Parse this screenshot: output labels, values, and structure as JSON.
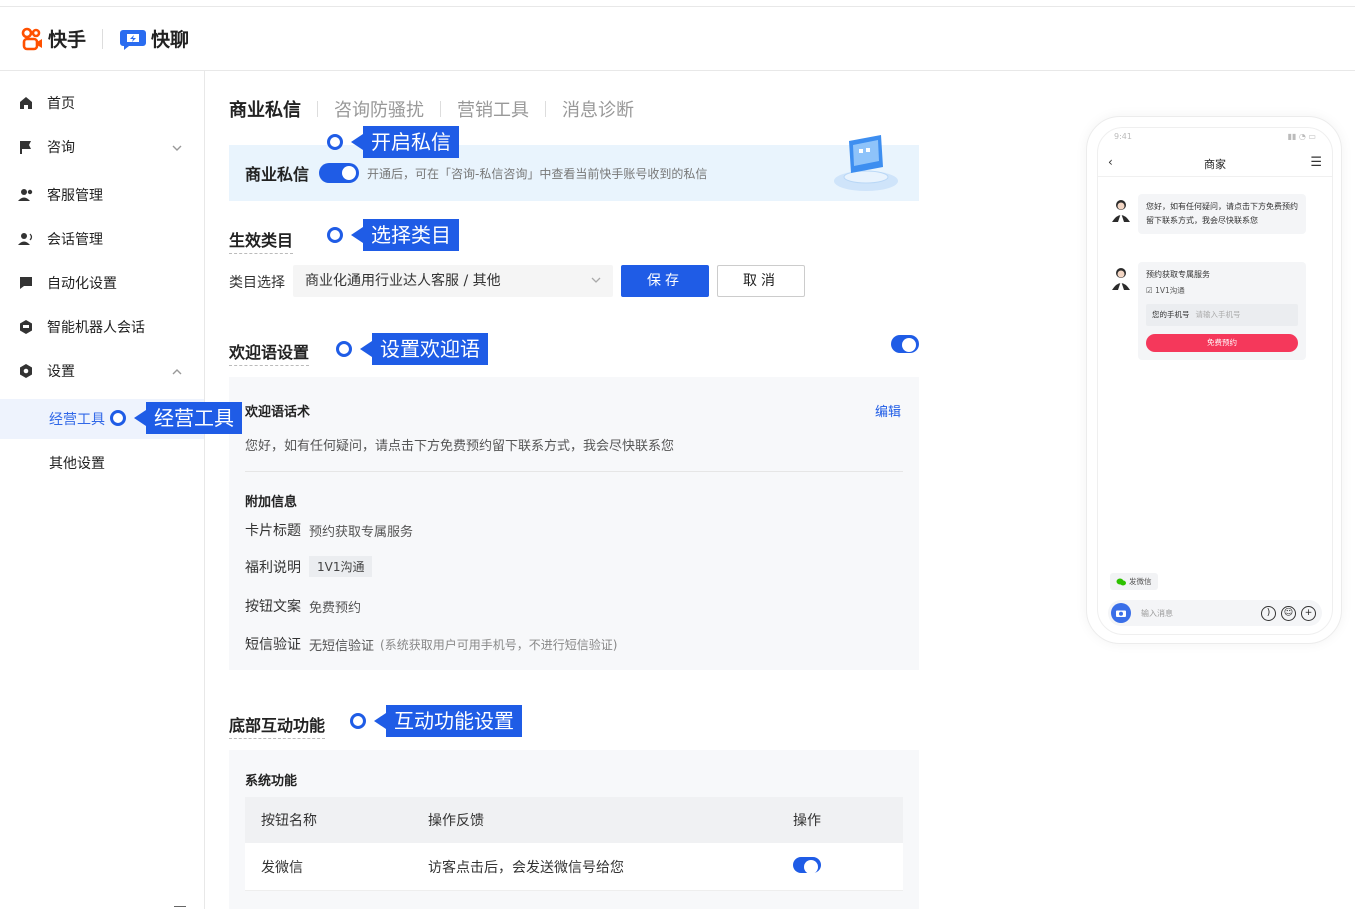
{
  "header": {
    "brand1": "快手",
    "brand2": "快聊"
  },
  "sidebar": {
    "items": [
      {
        "label": "首页",
        "icon": "home-icon"
      },
      {
        "label": "咨询",
        "icon": "flag-icon"
      },
      {
        "label": "客服管理",
        "icon": "users-icon"
      },
      {
        "label": "会话管理",
        "icon": "user-voice-icon"
      },
      {
        "label": "自动化设置",
        "icon": "chat-icon"
      },
      {
        "label": "智能机器人会话",
        "icon": "robot-icon"
      },
      {
        "label": "设置",
        "icon": "gear-icon"
      }
    ],
    "sub_items": [
      {
        "label": "经营工具"
      },
      {
        "label": "其他设置"
      }
    ]
  },
  "tabs": [
    "商业私信",
    "咨询防骚扰",
    "营销工具",
    "消息诊断"
  ],
  "banner": {
    "title": "商业私信",
    "desc": "开通后，可在「咨询-私信咨询」中查看当前快手账号收到的私信"
  },
  "category": {
    "title": "生效类目",
    "label": "类目选择",
    "selected": "商业化通用行业达人客服 / 其他",
    "save": "保存",
    "cancel": "取消"
  },
  "welcome": {
    "title": "欢迎语设置",
    "script_title": "欢迎语话术",
    "edit": "编辑",
    "script_text": "您好，如有任何疑问，请点击下方免费预约留下联系方式，我会尽快联系您",
    "extra_title": "附加信息",
    "card_title_label": "卡片标题",
    "card_title_value": "预约获取专属服务",
    "benefit_label": "福利说明",
    "benefit_value": "1V1沟通",
    "button_label": "按钮文案",
    "button_value": "免费预约",
    "sms_label": "短信验证",
    "sms_value": "无短信验证",
    "sms_note": "(系统获取用户可用手机号，不进行短信验证)"
  },
  "bottom": {
    "title": "底部互动功能",
    "system_title": "系统功能",
    "columns": [
      "按钮名称",
      "操作反馈",
      "操作"
    ],
    "rows": [
      {
        "name": "发微信",
        "feedback": "访客点击后，会发送微信号给您",
        "enabled": true
      }
    ]
  },
  "annotations": {
    "open": "开启私信",
    "select": "选择类目",
    "welcome": "设置欢迎语",
    "tools": "经营工具",
    "interact": "互动功能设置"
  },
  "phone": {
    "time": "9:41",
    "title": "商家",
    "msg1": "您好，如有任何疑问，请点击下方免费预约留下联系方式，我会尽快联系您",
    "card_title": "预约获取专属服务",
    "card_benefit": "1V1沟通",
    "phone_label": "您的手机号",
    "phone_placeholder": "请输入手机号",
    "card_button": "免费预约",
    "wechat": "发微信",
    "input_placeholder": "输入消息"
  },
  "colors": {
    "accent": "#1f5ce6",
    "banner_bg": "#e9f4fd",
    "cta": "#f5385b"
  }
}
